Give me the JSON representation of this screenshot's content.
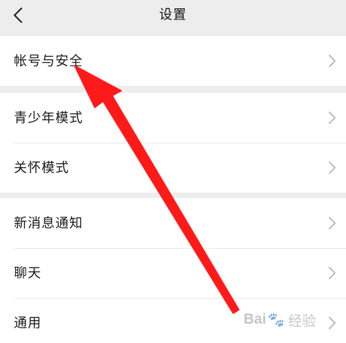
{
  "header": {
    "title": "设置",
    "back_icon": "chevron-left-icon"
  },
  "groups": [
    {
      "items": [
        {
          "label": "帐号与安全"
        }
      ]
    },
    {
      "items": [
        {
          "label": "青少年模式"
        },
        {
          "label": "关怀模式"
        }
      ]
    },
    {
      "items": [
        {
          "label": "新消息通知"
        },
        {
          "label": "聊天"
        },
        {
          "label": "通用"
        }
      ]
    }
  ],
  "annotation": {
    "arrow_color": "#ff1a1a"
  },
  "watermark": {
    "brand_a": "Bai",
    "brand_b": "经验",
    "icon": "paw-icon"
  },
  "colors": {
    "background": "#ededed",
    "row": "#ffffff",
    "chevron": "#b2b2b2"
  }
}
